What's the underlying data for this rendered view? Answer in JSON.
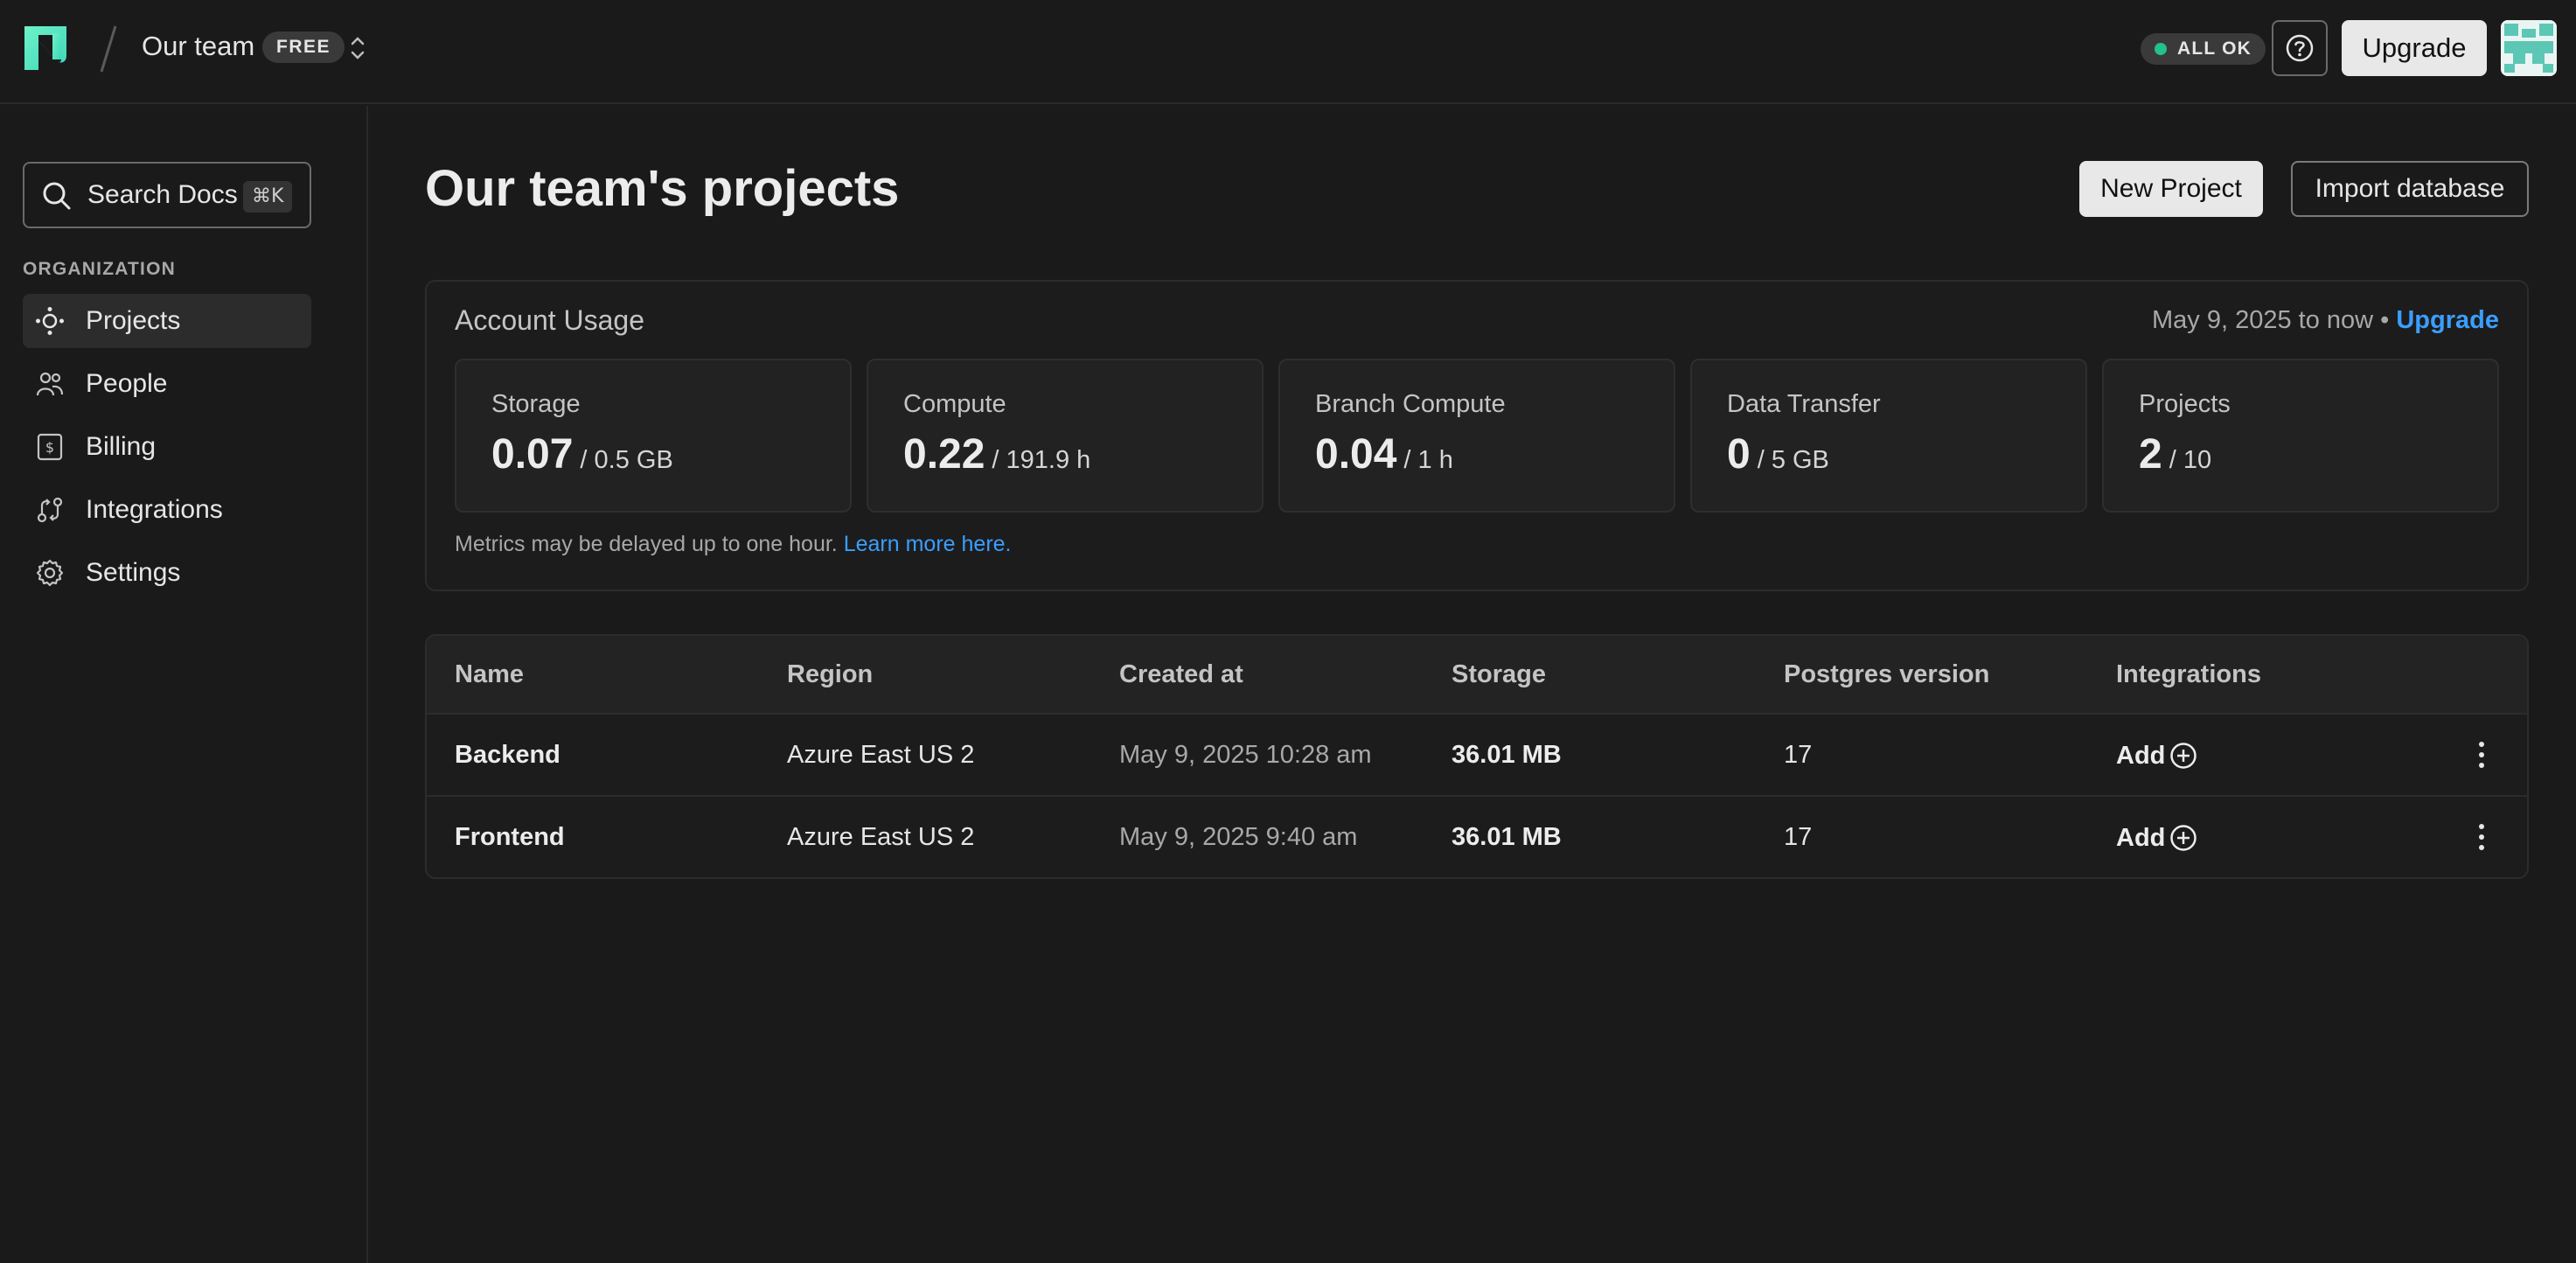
{
  "topbar": {
    "team_name": "Our team",
    "plan_badge": "FREE",
    "status_label": "ALL OK",
    "upgrade_label": "Upgrade"
  },
  "sidebar": {
    "search_label": "Search Docs",
    "search_shortcut": "⌘K",
    "section_label": "ORGANIZATION",
    "items": [
      {
        "label": "Projects",
        "icon": "projects-icon",
        "active": true
      },
      {
        "label": "People",
        "icon": "people-icon"
      },
      {
        "label": "Billing",
        "icon": "billing-icon"
      },
      {
        "label": "Integrations",
        "icon": "integrations-icon"
      },
      {
        "label": "Settings",
        "icon": "gear-icon"
      }
    ]
  },
  "main": {
    "title": "Our team's projects",
    "new_project_label": "New Project",
    "import_label": "Import database",
    "usage": {
      "title": "Account Usage",
      "range": "May 9, 2025 to now •",
      "upgrade_link": "Upgrade",
      "metrics": [
        {
          "label": "Storage",
          "value": "0.07",
          "unit": "/ 0.5 GB"
        },
        {
          "label": "Compute",
          "value": "0.22",
          "unit": "/ 191.9 h"
        },
        {
          "label": "Branch Compute",
          "value": "0.04",
          "unit": "/ 1 h"
        },
        {
          "label": "Data Transfer",
          "value": "0",
          "unit": "/ 5 GB"
        },
        {
          "label": "Projects",
          "value": "2",
          "unit": "/ 10"
        }
      ],
      "note": "Metrics may be delayed up to one hour.",
      "note_link": "Learn more here."
    },
    "table": {
      "columns": [
        "Name",
        "Region",
        "Created at",
        "Storage",
        "Postgres version",
        "Integrations"
      ],
      "rows": [
        {
          "name": "Backend",
          "region": "Azure East US 2",
          "created": "May 9, 2025 10:28 am",
          "storage": "36.01 MB",
          "pg": "17",
          "integration": "Add"
        },
        {
          "name": "Frontend",
          "region": "Azure East US 2",
          "created": "May 9, 2025 9:40 am",
          "storage": "36.01 MB",
          "pg": "17",
          "integration": "Add"
        }
      ]
    }
  },
  "colors": {
    "background": "#1a1a1a",
    "accent_link": "#3b9eff",
    "status_ok": "#22c28a",
    "logo": "#4de8c0"
  }
}
